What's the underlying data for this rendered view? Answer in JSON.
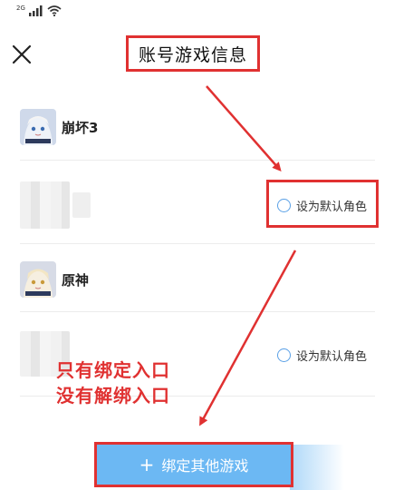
{
  "status_bar": {
    "network_label": "2G"
  },
  "header": {
    "title": "账号游戏信息"
  },
  "games": [
    {
      "name": "崩坏3",
      "icon": "honkai-impact-3-icon",
      "default_role_label": "设为默认角色"
    },
    {
      "name": "原神",
      "icon": "genshin-impact-icon",
      "default_role_label": "设为默认角色"
    }
  ],
  "annotation": {
    "line1": "只有绑定入口",
    "line2": "没有解绑入口",
    "color": "#e03131"
  },
  "bind_button": {
    "label": "绑定其他游戏",
    "color": "#6cb8f3"
  }
}
